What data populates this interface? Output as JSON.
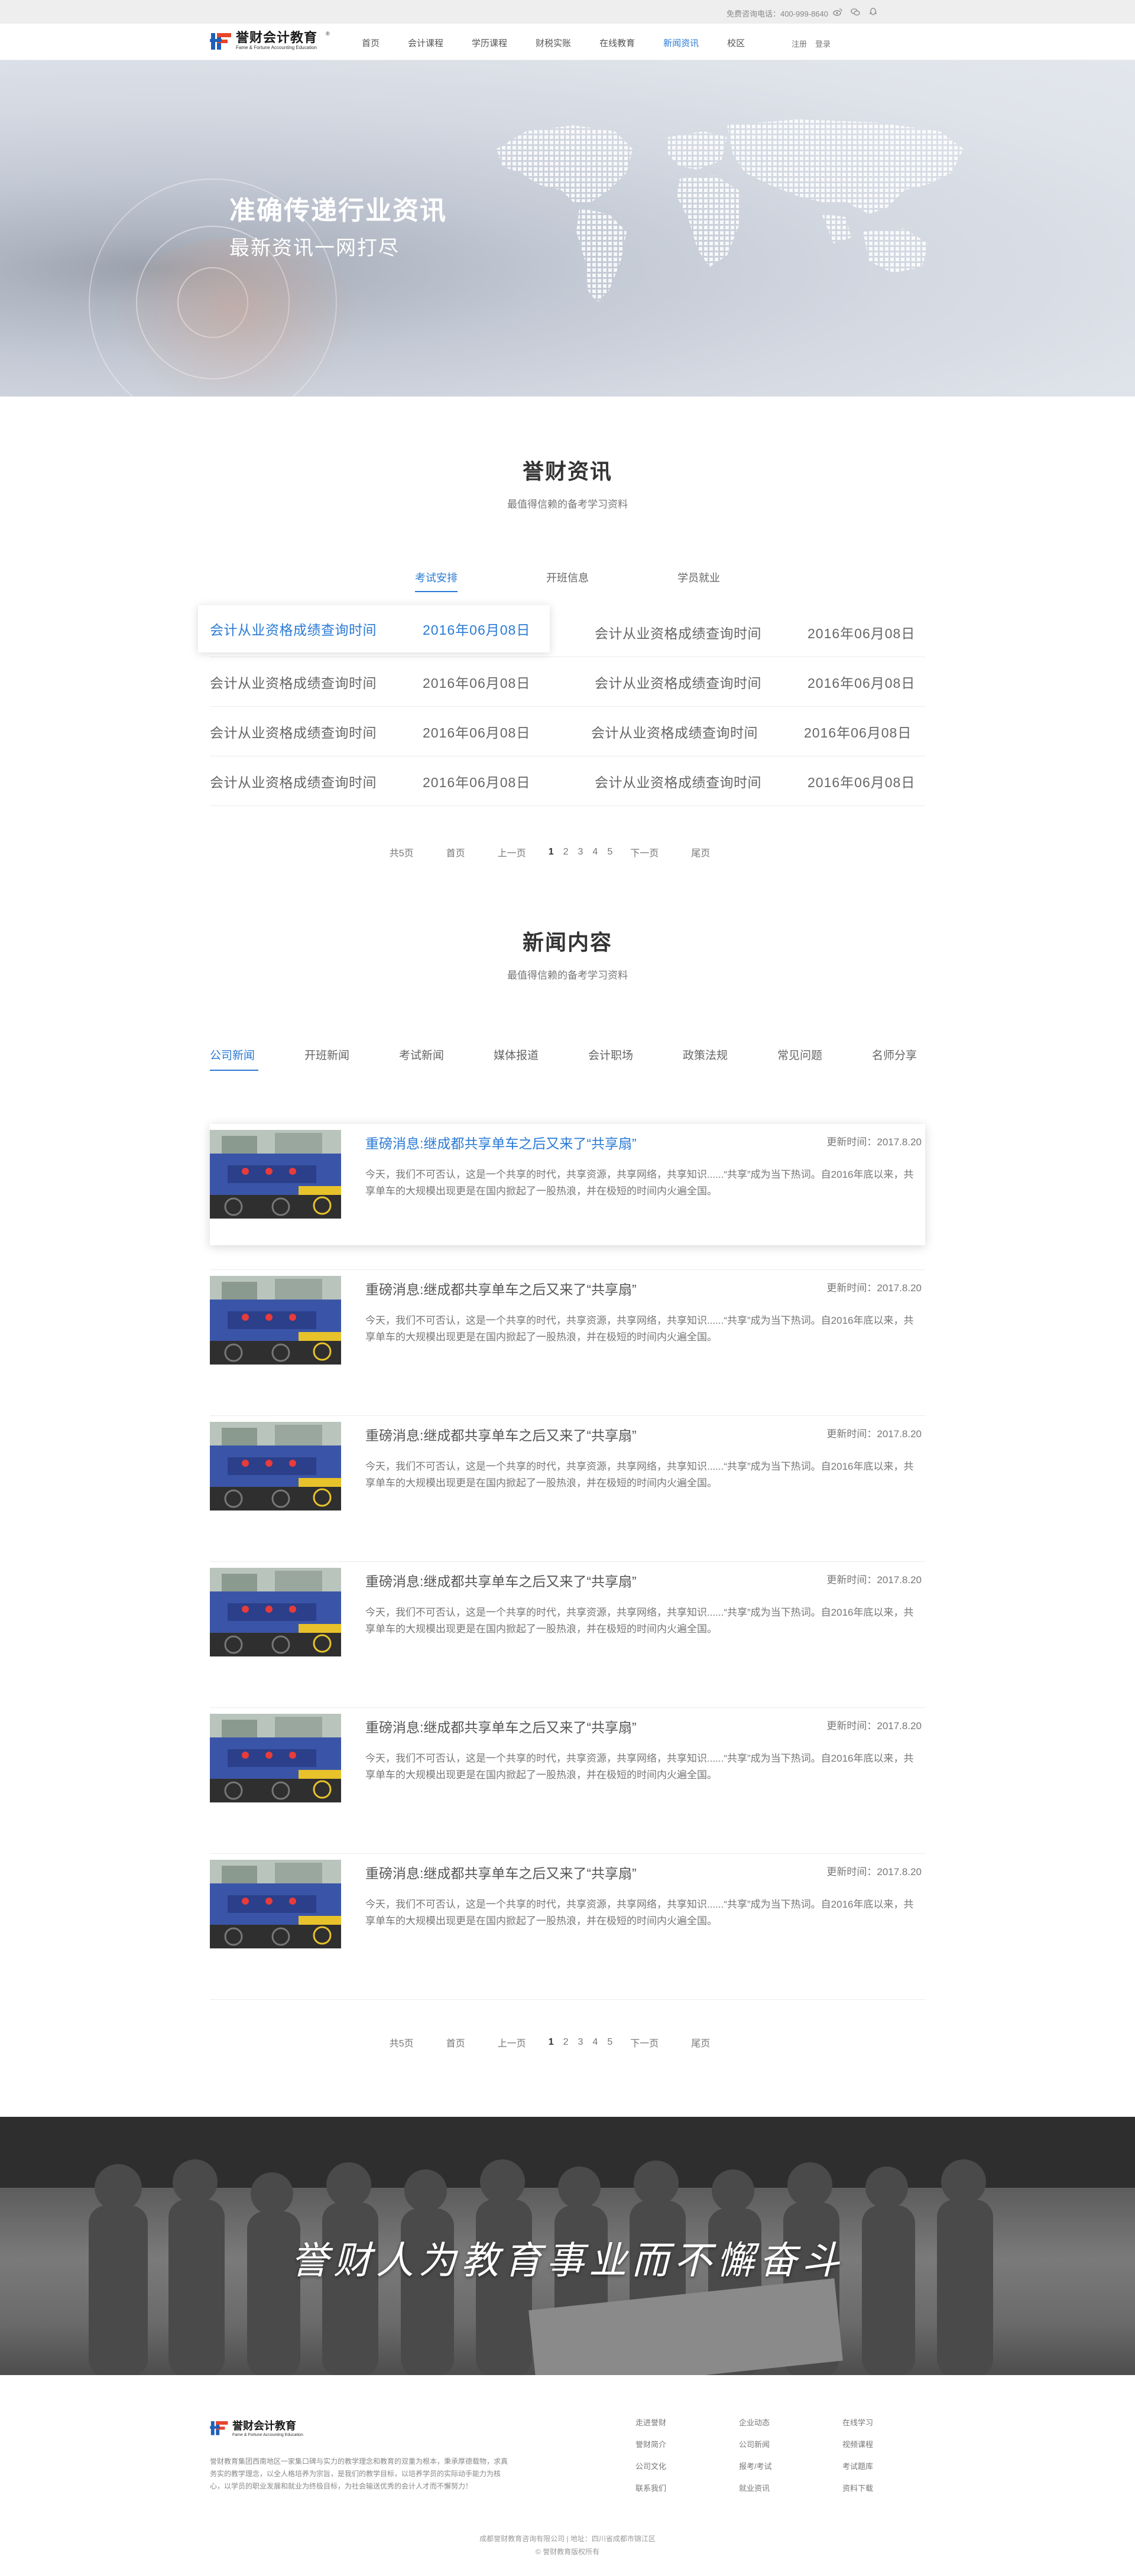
{
  "topbar": {
    "hotline": "免费咨询电话：400-999-8640",
    "icons": [
      "weibo-icon",
      "wechat-icon",
      "qq-icon"
    ]
  },
  "header": {
    "logo_cn": "誉财会计教育",
    "logo_en": "Fame & Fortune Accounting Education",
    "logo_reg": "®",
    "nav": [
      "首页",
      "会计课程",
      "学历课程",
      "财税实账",
      "在线教育",
      "新闻资讯",
      "校区"
    ],
    "active_nav_index": 5,
    "register": "注册",
    "login": "登录"
  },
  "hero": {
    "title": "准确传递行业资讯",
    "subtitle": "最新资讯一网打尽"
  },
  "info": {
    "title": "誉财资讯",
    "subtitle": "最值得信赖的备考学习资料",
    "tabs": [
      "考试安排",
      "开班信息",
      "学员就业"
    ],
    "active_tab": 0,
    "rows": [
      [
        {
          "title": "会计从业资格成绩查询时间",
          "date": "2016年06月08日"
        },
        {
          "title": "会计从业资格成绩查询时间",
          "date": "2016年06月08日"
        }
      ],
      [
        {
          "title": "会计从业资格成绩查询时间",
          "date": "2016年06月08日"
        },
        {
          "title": "会计从业资格成绩查询时间",
          "date": "2016年06月08日"
        }
      ],
      [
        {
          "title": "会计从业资格成绩查询时间",
          "date": "2016年06月08日"
        },
        {
          "title": "会计从业资格成绩查询时间",
          "date": "2016年06月08日"
        }
      ],
      [
        {
          "title": "会计从业资格成绩查询时间",
          "date": "2016年06月08日"
        },
        {
          "title": "会计从业资格成绩查询时间",
          "date": "2016年06月08日"
        }
      ]
    ]
  },
  "pager1": {
    "total": "共5页",
    "first": "首页",
    "prev": "上一页",
    "pages": [
      "1",
      "2",
      "3",
      "4",
      "5"
    ],
    "current": 0,
    "next": "下一页",
    "last": "尾页"
  },
  "news": {
    "title": "新闻内容",
    "subtitle": "最值得信赖的备考学习资料",
    "tabs": [
      "公司新闻",
      "开班新闻",
      "考试新闻",
      "媒体报道",
      "会计职场",
      "政策法规",
      "常见问题",
      "名师分享"
    ],
    "active_tab": 0,
    "items": [
      {
        "title": "重磅消息:继成都共享单车之后又来了“共享扇”",
        "date": "更新时间：2017.8.20",
        "desc": "今天，我们不可否认，这是一个共享的时代，共享资源，共享网络，共享知识......“共享”成为当下热词。自2016年底以来，共享单车的大规模出现更是在国内掀起了一股热浪，并在极短的时间内火遍全国。"
      },
      {
        "title": "重磅消息:继成都共享单车之后又来了“共享扇”",
        "date": "更新时间：2017.8.20",
        "desc": "今天，我们不可否认，这是一个共享的时代，共享资源，共享网络，共享知识......“共享”成为当下热词。自2016年底以来，共享单车的大规模出现更是在国内掀起了一股热浪，并在极短的时间内火遍全国。"
      },
      {
        "title": "重磅消息:继成都共享单车之后又来了“共享扇”",
        "date": "更新时间：2017.8.20",
        "desc": "今天，我们不可否认，这是一个共享的时代，共享资源，共享网络，共享知识......“共享”成为当下热词。自2016年底以来，共享单车的大规模出现更是在国内掀起了一股热浪，并在极短的时间内火遍全国。"
      },
      {
        "title": "重磅消息:继成都共享单车之后又来了“共享扇”",
        "date": "更新时间：2017.8.20",
        "desc": "今天，我们不可否认，这是一个共享的时代，共享资源，共享网络，共享知识......“共享”成为当下热词。自2016年底以来，共享单车的大规模出现更是在国内掀起了一股热浪，并在极短的时间内火遍全国。"
      },
      {
        "title": "重磅消息:继成都共享单车之后又来了“共享扇”",
        "date": "更新时间：2017.8.20",
        "desc": "今天，我们不可否认，这是一个共享的时代，共享资源，共享网络，共享知识......“共享”成为当下热词。自2016年底以来，共享单车的大规模出现更是在国内掀起了一股热浪，并在极短的时间内火遍全国。"
      },
      {
        "title": "重磅消息:继成都共享单车之后又来了“共享扇”",
        "date": "更新时间：2017.8.20",
        "desc": "今天，我们不可否认，这是一个共享的时代，共享资源，共享网络，共享知识......“共享”成为当下热词。自2016年底以来，共享单车的大规模出现更是在国内掀起了一股热浪，并在极短的时间内火遍全国。"
      }
    ]
  },
  "pager2": {
    "total": "共5页",
    "first": "首页",
    "prev": "上一页",
    "pages": [
      "1",
      "2",
      "3",
      "4",
      "5"
    ],
    "current": 0,
    "next": "下一页",
    "last": "尾页"
  },
  "banner": {
    "slogan": "誉财人为教育事业而不懈奋斗"
  },
  "footer": {
    "logo_cn": "誉财会计教育",
    "logo_en": "Fame & Fortune Accounting Education",
    "about": "誉财教育集团西南地区一家集口碑与实力的教学理念和教育的双重为根本，秉承厚德载物，求真务实的教学理念，以全人格培养为宗旨，是我们的教学目标，以培养学员的实际动手能力为核心，以学员的职业发展和就业为终极目标，为社会输送优秀的会计人才而不懈努力！",
    "col1": [
      "走进誉财",
      "誉财简介",
      "公司文化",
      "联系我们"
    ],
    "col2": [
      "企业动态",
      "公司新闻",
      "报考/考试",
      "就业资讯"
    ],
    "col3": [
      "在线学习",
      "视频课程",
      "考试题库",
      "资料下载"
    ],
    "copy1": "成都誉财教育咨询有限公司  |  地址：四川省成都市锦江区",
    "copy2": "©  誉财教育版权所有"
  },
  "colors": {
    "accent": "#2a7ad5",
    "text": "#555555",
    "topbar": "#eeeeee"
  }
}
